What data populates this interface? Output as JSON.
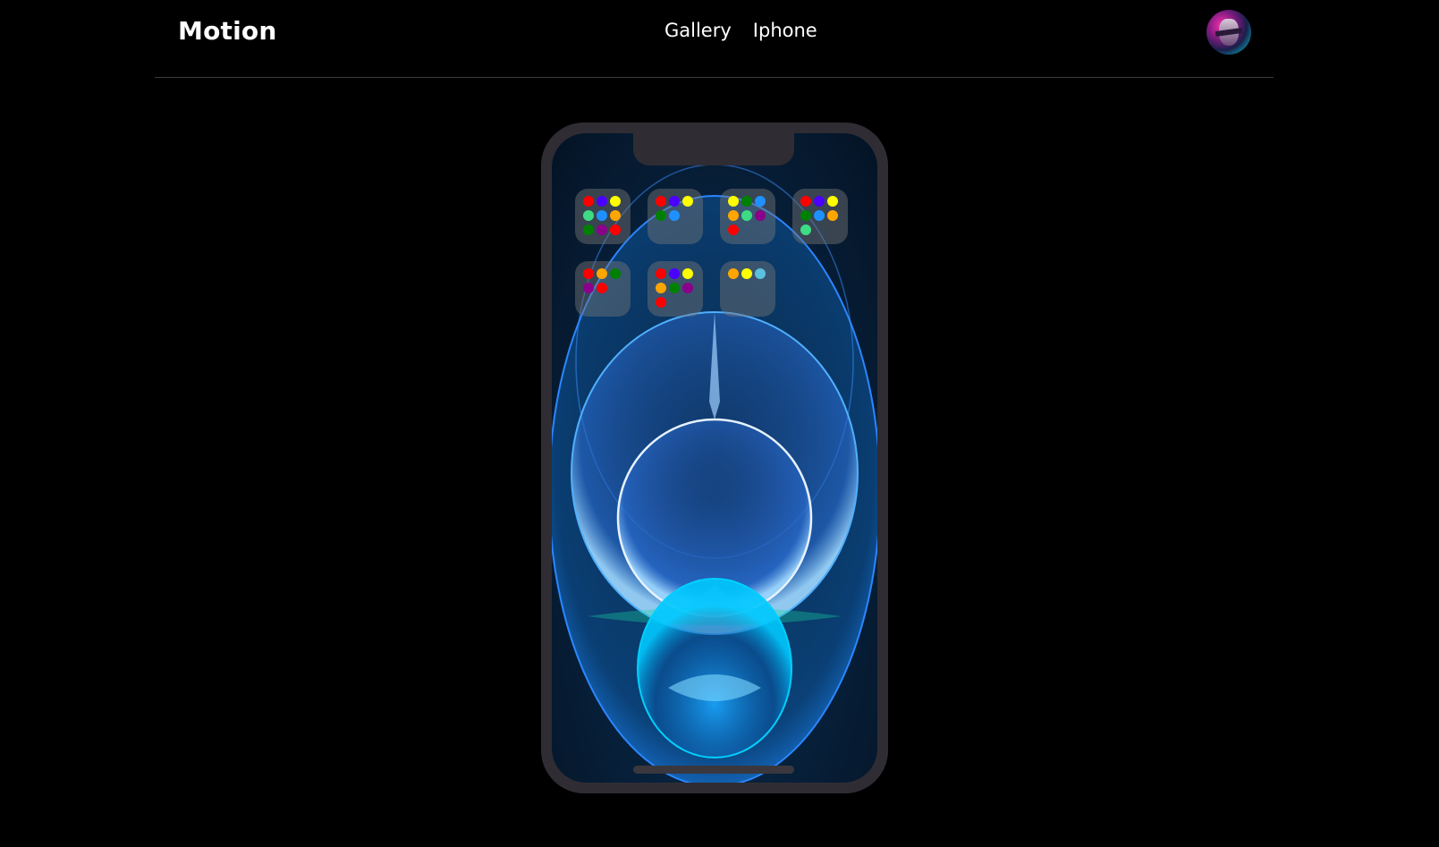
{
  "header": {
    "brand": "Motion",
    "nav": [
      {
        "label": "Gallery"
      },
      {
        "label": "Iphone"
      }
    ],
    "avatar_icon": "user-avatar"
  },
  "phone": {
    "wallpaper_icon": "iphone-12-wallpaper",
    "folders": [
      {
        "dots": [
          "#ff0000",
          "#4b00ff",
          "#ffff00",
          "#3ddc84",
          "#1e90ff",
          "#ffa500",
          "#008000",
          "#8b008b",
          "#ff0000"
        ]
      },
      {
        "dots": [
          "#ff0000",
          "#4b00ff",
          "#ffff00",
          "#008000",
          "#1e90ff"
        ]
      },
      {
        "dots": [
          "#ffff00",
          "#008000",
          "#1e90ff",
          "#ffa500",
          "#3ddc84",
          "#8b008b",
          "#ff0000"
        ]
      },
      {
        "dots": [
          "#ff0000",
          "#4b00ff",
          "#ffff00",
          "#008000",
          "#1e90ff",
          "#ffa500",
          "#3ddc84"
        ]
      },
      {
        "dots": [
          "#ff0000",
          "#ffa500",
          "#008000",
          "#8b008b",
          "#ff0000"
        ]
      },
      {
        "dots": [
          "#ff0000",
          "#4b00ff",
          "#ffff00",
          "#ffa500",
          "#008000",
          "#8b008b",
          "#ff0000"
        ]
      },
      {
        "dots": [
          "#ffa500",
          "#ffff00",
          "#5bc0de"
        ]
      }
    ]
  }
}
